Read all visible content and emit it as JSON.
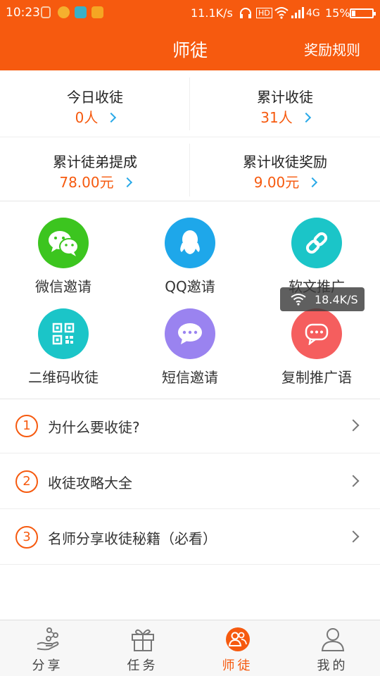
{
  "status_bar": {
    "time": "10:23",
    "network_speed": "11.1K/s",
    "hd": "HD",
    "network": "4G",
    "battery": "15%"
  },
  "header": {
    "title": "师徒",
    "rules_label": "奖励规则"
  },
  "stats": [
    {
      "label": "今日收徒",
      "value": "0人"
    },
    {
      "label": "累计收徒",
      "value": "31人"
    },
    {
      "label": "累计徒弟提成",
      "value": "78.00元"
    },
    {
      "label": "累计收徒奖励",
      "value": "9.00元"
    }
  ],
  "invite_actions": [
    {
      "label": "微信邀请",
      "icon": "wechat-icon",
      "color": "#3cc51f"
    },
    {
      "label": "QQ邀请",
      "icon": "qq-icon",
      "color": "#1ea7ea"
    },
    {
      "label": "软文推广",
      "icon": "link-icon",
      "color": "#1bc5c8"
    },
    {
      "label": "二维码收徒",
      "icon": "qrcode-icon",
      "color": "#1bc5c8"
    },
    {
      "label": "短信邀请",
      "icon": "sms-icon",
      "color": "#9a83f0"
    },
    {
      "label": "复制推广语",
      "icon": "chat-icon",
      "color": "#f55e5e"
    }
  ],
  "speed_widget": {
    "text": "18.4K/S"
  },
  "guide_list": [
    {
      "number": "1",
      "text": "为什么要收徒?"
    },
    {
      "number": "2",
      "text": "收徒攻略大全"
    },
    {
      "number": "3",
      "text": "名师分享收徒秘籍（必看）"
    }
  ],
  "tabs": [
    {
      "label": "分享",
      "icon": "share-hand-icon",
      "active": false
    },
    {
      "label": "任务",
      "icon": "gift-icon",
      "active": false
    },
    {
      "label": "师徒",
      "icon": "people-icon",
      "active": true
    },
    {
      "label": "我的",
      "icon": "user-icon",
      "active": false
    }
  ],
  "colors": {
    "brand": "#f65a0f",
    "chevron_accent": "#29a9e8"
  }
}
